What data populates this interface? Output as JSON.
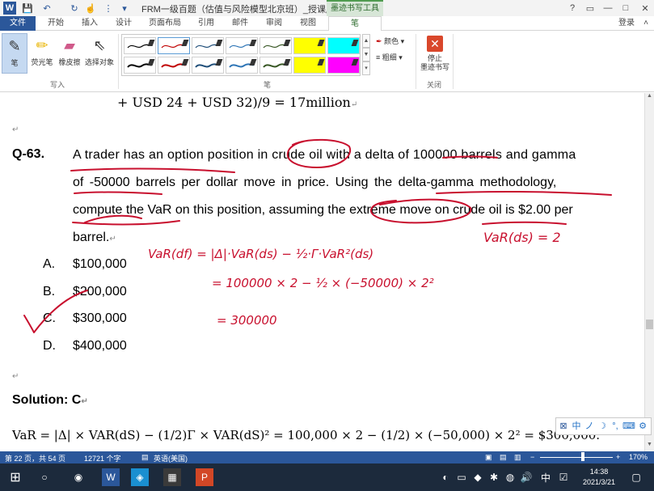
{
  "titlebar": {
    "title": "FRM一级百题（估值与风险模型北京班）_授课版 [兼容...",
    "context_tab": "墨迹书写工具",
    "help": "?",
    "restore": "▭",
    "minimize": "—",
    "maximize": "□",
    "close": "✕"
  },
  "ribbon_tabs": [
    "文件",
    "开始",
    "插入",
    "设计",
    "页面布局",
    "引用",
    "邮件",
    "审阅",
    "视图",
    "笔"
  ],
  "account": "登录",
  "ribbon": {
    "write_tools": [
      "笔",
      "荧光笔",
      "橡皮擦",
      "选择对象"
    ],
    "write_group": "写入",
    "pen_group": "笔",
    "color_label": "颜色",
    "thickness_label": "粗细",
    "stop_label": "停止\n墨迹书写",
    "close_group": "关闭",
    "swatch_colors": [
      [
        "#000000",
        "#c00000",
        "#1f4e79",
        "#2e75b6",
        "#375623",
        "#ffff00",
        "#00ffff"
      ],
      [
        "#000000",
        "#c00000",
        "#1f4e79",
        "#2e75b6",
        "#375623",
        "#ffff00",
        "#ff00ff"
      ]
    ]
  },
  "doc": {
    "top_equation": "+ USD 24 + USD 32)/9 = 17million",
    "question_number": "Q-63.",
    "question_lines": [
      "A trader has an option position in crude oil with a delta of 100000 barrels and gamma",
      "of -50000 barrels per dollar move in price. Using the delta-gamma methodology,",
      "compute the VaR on this position, assuming the extreme move on crude oil is $2.00 per",
      "barrel."
    ],
    "options": [
      {
        "letter": "A.",
        "value": "$100,000"
      },
      {
        "letter": "B.",
        "value": "$200,000"
      },
      {
        "letter": "C.",
        "value": "$300,000"
      },
      {
        "letter": "D.",
        "value": "$400,000"
      }
    ],
    "solution_label": "Solution: C",
    "bottom_equation": "VaR = |Δ| × VAR(dS) − (1/2)Γ × VAR(dS)² = 100,000 × 2 − (1/2) × (−50,000) × 2² = $300,000.",
    "handwriting": {
      "line1": "VaR(df) = |Δ|·VaR(ds) − ½·Γ·VaR²(ds)",
      "line2": "= 100000 × 2 − ½ × (−50000) × 2²",
      "line3": "= 300000",
      "side": "VaR(ds) = 2"
    },
    "para_mark": "↵"
  },
  "statusbar": {
    "page": "第 22 页，共 54 页",
    "words": "12721 个字",
    "language": "英语(美国)",
    "zoom": "170%"
  },
  "taskbar": {
    "time": "14:38",
    "date": "2021/3/21",
    "ime_lang": "中"
  },
  "ime_bar": [
    "中",
    "ノ",
    "☽",
    "°,",
    "⌨",
    "⚙"
  ]
}
